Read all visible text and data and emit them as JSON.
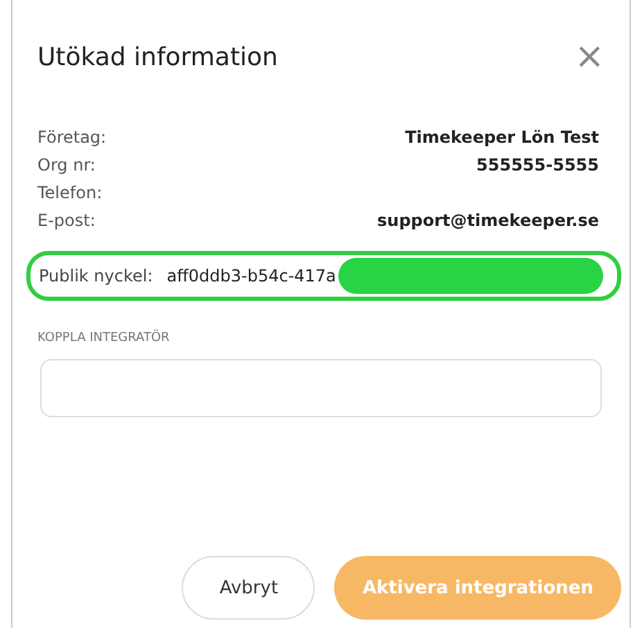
{
  "dialog": {
    "title": "Utökad information",
    "close": "×"
  },
  "details": [
    {
      "label": "Företag:",
      "value": "Timekeeper Lön Test"
    },
    {
      "label": "Org nr:",
      "value": "555555-5555"
    },
    {
      "label": "Telefon:"
    },
    {
      "label": "E-post:",
      "value": "support@timekeeper.se"
    }
  ],
  "public_key": {
    "label": "Publik nyckel:",
    "value": "aff0ddb3-b54c-417a",
    "highlighted": true,
    "redacted": true
  },
  "integrator": {
    "label": "KOPPLA INTEGRATÖR"
  },
  "buttons": [
    {
      "label": "Avbryt",
      "kind": "secondary"
    },
    {
      "label": "Aktivera integrationen",
      "kind": "primary"
    }
  ]
}
